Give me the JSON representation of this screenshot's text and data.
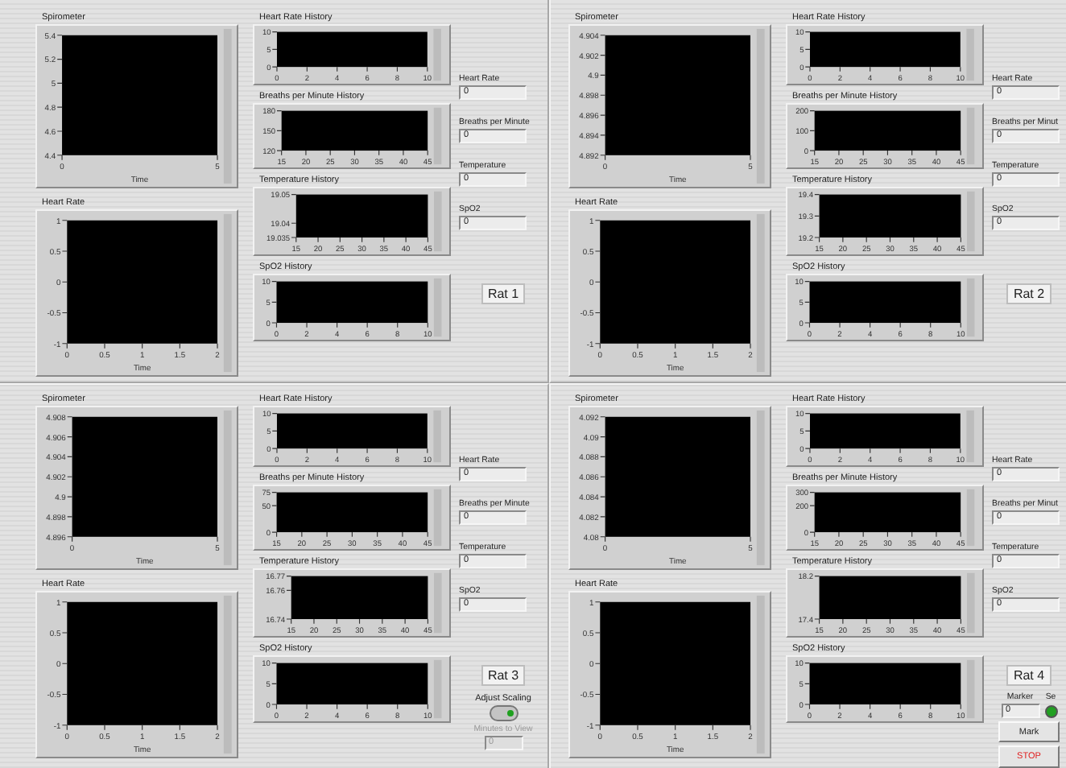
{
  "rats": [
    {
      "label": "Rat 1",
      "graphs": [
        {
          "chart_data": {
            "type": "line",
            "title": "Spirometer",
            "xlabel": "Time",
            "xlim": [
              0,
              5
            ],
            "ylim": [
              4.4,
              5.4
            ],
            "xticks": [
              0,
              5
            ],
            "yticks": [
              4.4,
              4.6,
              4.8,
              5,
              5.2,
              5.4
            ]
          }
        },
        {
          "chart_data": {
            "type": "line",
            "title": "Heart Rate",
            "xlabel": "Time",
            "xlim": [
              0,
              2
            ],
            "ylim": [
              -1,
              1
            ],
            "xticks": [
              0,
              0.5,
              1,
              1.5,
              2
            ],
            "yticks": [
              -1,
              -0.5,
              0,
              0.5,
              1
            ]
          }
        },
        {
          "chart_data": {
            "type": "line",
            "title": "Heart Rate History",
            "xlim": [
              0,
              10
            ],
            "ylim": [
              0,
              10
            ],
            "xticks": [
              0,
              2,
              4,
              6,
              8,
              10
            ],
            "yticks": [
              0,
              5,
              10
            ]
          }
        },
        {
          "chart_data": {
            "type": "line",
            "title": "Breaths per Minute History",
            "xlim": [
              15,
              45
            ],
            "ylim": [
              120,
              180
            ],
            "xticks": [
              15,
              20,
              25,
              30,
              35,
              40,
              45
            ],
            "yticks": [
              120,
              150,
              180
            ]
          }
        },
        {
          "chart_data": {
            "type": "line",
            "title": "Temperature History",
            "xlim": [
              15,
              45
            ],
            "ylim": [
              19.035,
              19.05
            ],
            "xticks": [
              15,
              20,
              25,
              30,
              35,
              40,
              45
            ],
            "yticks": [
              19.035,
              19.04,
              19.05
            ]
          }
        },
        {
          "chart_data": {
            "type": "line",
            "title": "SpO2 History",
            "xlim": [
              0,
              10
            ],
            "ylim": [
              0,
              10
            ],
            "xticks": [
              0,
              2,
              4,
              6,
              8,
              10
            ],
            "yticks": [
              0,
              5,
              10
            ]
          }
        }
      ],
      "readouts": [
        {
          "label": "Heart Rate",
          "value": "0"
        },
        {
          "label": "Breaths per Minute",
          "value": "0"
        },
        {
          "label": "Temperature",
          "value": "0"
        },
        {
          "label": "SpO2",
          "value": "0"
        }
      ]
    },
    {
      "label": "Rat 2",
      "graphs": [
        {
          "chart_data": {
            "type": "line",
            "title": "Spirometer",
            "xlabel": "Time",
            "xlim": [
              0,
              5
            ],
            "ylim": [
              4.892,
              4.904
            ],
            "xticks": [
              0,
              5
            ],
            "yticks": [
              4.892,
              4.894,
              4.896,
              4.898,
              4.9,
              4.902,
              4.904
            ]
          }
        },
        {
          "chart_data": {
            "type": "line",
            "title": "Heart Rate",
            "xlabel": "Time",
            "xlim": [
              0,
              2
            ],
            "ylim": [
              -1,
              1
            ],
            "xticks": [
              0,
              0.5,
              1,
              1.5,
              2
            ],
            "yticks": [
              -1,
              -0.5,
              0,
              0.5,
              1
            ]
          }
        },
        {
          "chart_data": {
            "type": "line",
            "title": "Heart Rate History",
            "xlim": [
              0,
              10
            ],
            "ylim": [
              0,
              10
            ],
            "xticks": [
              0,
              2,
              4,
              6,
              8,
              10
            ],
            "yticks": [
              0,
              5,
              10
            ]
          }
        },
        {
          "chart_data": {
            "type": "line",
            "title": "Breaths per Minute History",
            "xlim": [
              15,
              45
            ],
            "ylim": [
              0,
              200
            ],
            "xticks": [
              15,
              20,
              25,
              30,
              35,
              40,
              45
            ],
            "yticks": [
              0,
              100,
              200
            ]
          }
        },
        {
          "chart_data": {
            "type": "line",
            "title": "Temperature History",
            "xlim": [
              15,
              45
            ],
            "ylim": [
              19.2,
              19.4
            ],
            "xticks": [
              15,
              20,
              25,
              30,
              35,
              40,
              45
            ],
            "yticks": [
              19.2,
              19.3,
              19.4
            ]
          }
        },
        {
          "chart_data": {
            "type": "line",
            "title": "SpO2 History",
            "xlim": [
              0,
              10
            ],
            "ylim": [
              0,
              10
            ],
            "xticks": [
              0,
              2,
              4,
              6,
              8,
              10
            ],
            "yticks": [
              0,
              5,
              10
            ]
          }
        }
      ],
      "readouts": [
        {
          "label": "Heart Rate",
          "value": "0"
        },
        {
          "label": "Breaths per Minut",
          "value": "0"
        },
        {
          "label": "Temperature",
          "value": "0"
        },
        {
          "label": "SpO2",
          "value": "0"
        }
      ]
    },
    {
      "label": "Rat 3",
      "graphs": [
        {
          "chart_data": {
            "type": "line",
            "title": "Spirometer",
            "xlabel": "Time",
            "xlim": [
              0,
              5
            ],
            "ylim": [
              4.896,
              4.908
            ],
            "xticks": [
              0,
              5
            ],
            "yticks": [
              4.896,
              4.898,
              4.9,
              4.902,
              4.904,
              4.906,
              4.908
            ]
          }
        },
        {
          "chart_data": {
            "type": "line",
            "title": "Heart Rate",
            "xlabel": "Time",
            "xlim": [
              0,
              2
            ],
            "ylim": [
              -1,
              1
            ],
            "xticks": [
              0,
              0.5,
              1,
              1.5,
              2
            ],
            "yticks": [
              -1,
              -0.5,
              0,
              0.5,
              1
            ]
          }
        },
        {
          "chart_data": {
            "type": "line",
            "title": "Heart Rate History",
            "xlim": [
              0,
              10
            ],
            "ylim": [
              0,
              10
            ],
            "xticks": [
              0,
              2,
              4,
              6,
              8,
              10
            ],
            "yticks": [
              0,
              5,
              10
            ]
          }
        },
        {
          "chart_data": {
            "type": "line",
            "title": "Breaths per Minute History",
            "xlim": [
              15,
              45
            ],
            "ylim": [
              0,
              75
            ],
            "xticks": [
              15,
              20,
              25,
              30,
              35,
              40,
              45
            ],
            "yticks": [
              0,
              50,
              75
            ]
          }
        },
        {
          "chart_data": {
            "type": "line",
            "title": "Temperature History",
            "xlim": [
              15,
              45
            ],
            "ylim": [
              16.74,
              16.77
            ],
            "xticks": [
              15,
              20,
              25,
              30,
              35,
              40,
              45
            ],
            "yticks": [
              16.74,
              16.76,
              16.77
            ]
          }
        },
        {
          "chart_data": {
            "type": "line",
            "title": "SpO2 History",
            "xlim": [
              0,
              10
            ],
            "ylim": [
              0,
              10
            ],
            "xticks": [
              0,
              2,
              4,
              6,
              8,
              10
            ],
            "yticks": [
              0,
              5,
              10
            ]
          }
        }
      ],
      "readouts": [
        {
          "label": "Heart Rate",
          "value": "0"
        },
        {
          "label": "Breaths per Minute",
          "value": "0"
        },
        {
          "label": "Temperature",
          "value": "0"
        },
        {
          "label": "SpO2",
          "value": "0"
        }
      ],
      "controls": [
        {
          "kind": "toggle",
          "label": "Adjust Scaling",
          "on": true
        },
        {
          "kind": "field",
          "label": "Minutes to View",
          "value": "0",
          "disabled": true
        }
      ]
    },
    {
      "label": "Rat 4",
      "graphs": [
        {
          "chart_data": {
            "type": "line",
            "title": "Spirometer",
            "xlabel": "Time",
            "xlim": [
              0,
              5
            ],
            "ylim": [
              4.08,
              4.092
            ],
            "xticks": [
              0,
              5
            ],
            "yticks": [
              4.08,
              4.082,
              4.084,
              4.086,
              4.088,
              4.09,
              4.092
            ]
          }
        },
        {
          "chart_data": {
            "type": "line",
            "title": "Heart Rate",
            "xlabel": "Time",
            "xlim": [
              0,
              2
            ],
            "ylim": [
              -1,
              1
            ],
            "xticks": [
              0,
              0.5,
              1,
              1.5,
              2
            ],
            "yticks": [
              -1,
              -0.5,
              0,
              0.5,
              1
            ]
          }
        },
        {
          "chart_data": {
            "type": "line",
            "title": "Heart Rate History",
            "xlim": [
              0,
              10
            ],
            "ylim": [
              0,
              10
            ],
            "xticks": [
              0,
              2,
              4,
              6,
              8,
              10
            ],
            "yticks": [
              0,
              5,
              10
            ]
          }
        },
        {
          "chart_data": {
            "type": "line",
            "title": "Breaths per Minute History",
            "xlim": [
              15,
              45
            ],
            "ylim": [
              0,
              300
            ],
            "xticks": [
              15,
              20,
              25,
              30,
              35,
              40,
              45
            ],
            "yticks": [
              0,
              200,
              300
            ]
          }
        },
        {
          "chart_data": {
            "type": "line",
            "title": "Temperature History",
            "xlim": [
              15,
              45
            ],
            "ylim": [
              17.4,
              18.2
            ],
            "xticks": [
              15,
              20,
              25,
              30,
              35,
              40,
              45
            ],
            "yticks": [
              17.4,
              18.2
            ]
          }
        },
        {
          "chart_data": {
            "type": "line",
            "title": "SpO2 History",
            "xlim": [
              0,
              10
            ],
            "ylim": [
              0,
              10
            ],
            "xticks": [
              0,
              2,
              4,
              6,
              8,
              10
            ],
            "yticks": [
              0,
              5,
              10
            ]
          }
        }
      ],
      "readouts": [
        {
          "label": "Heart Rate",
          "value": "0"
        },
        {
          "label": "Breaths per Minut",
          "value": "0"
        },
        {
          "label": "Temperature",
          "value": "0"
        },
        {
          "label": "SpO2",
          "value": "0"
        }
      ],
      "controls": [
        {
          "kind": "field",
          "label": "Marker",
          "value": "0",
          "disabled": false
        },
        {
          "kind": "led",
          "label": "Se",
          "on": true
        },
        {
          "kind": "button",
          "label": "Mark"
        },
        {
          "kind": "stop",
          "label": "STOP"
        }
      ]
    }
  ]
}
